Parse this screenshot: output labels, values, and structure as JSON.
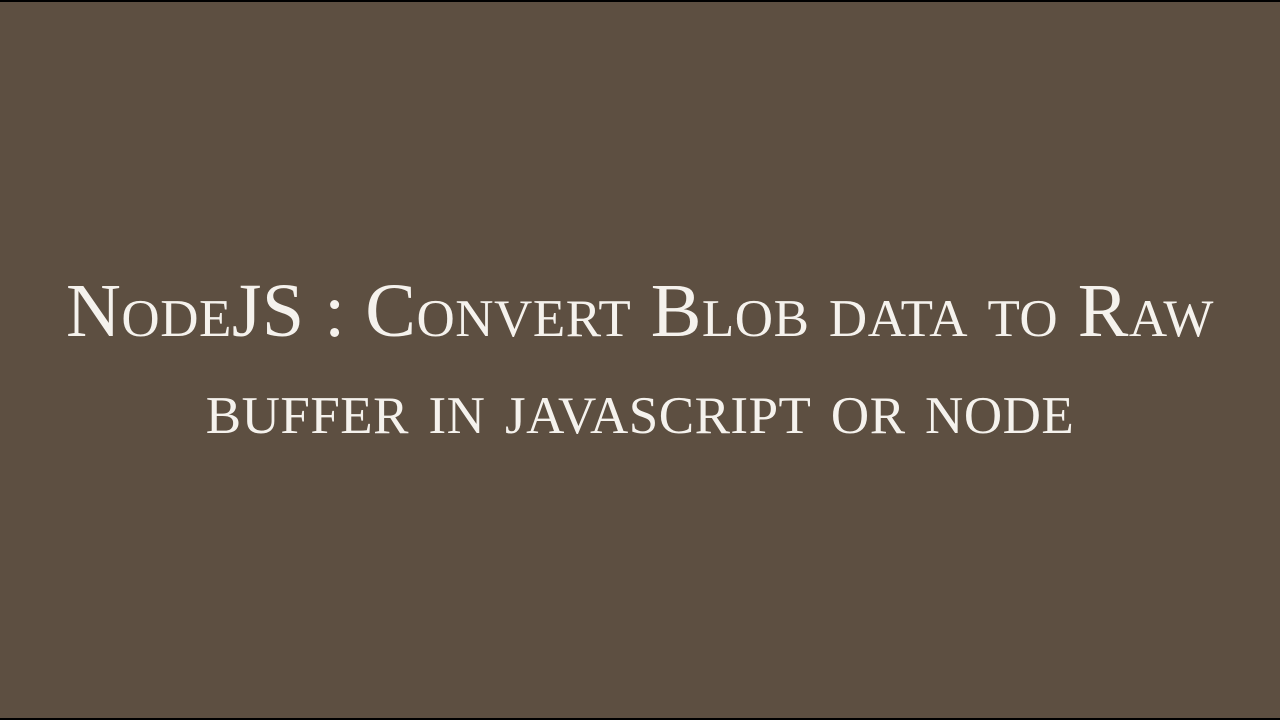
{
  "title": "NodeJS : Convert Blob data to Raw buffer in javascript or node",
  "colors": {
    "background": "#5d4f41",
    "text": "#f5f2ed"
  }
}
